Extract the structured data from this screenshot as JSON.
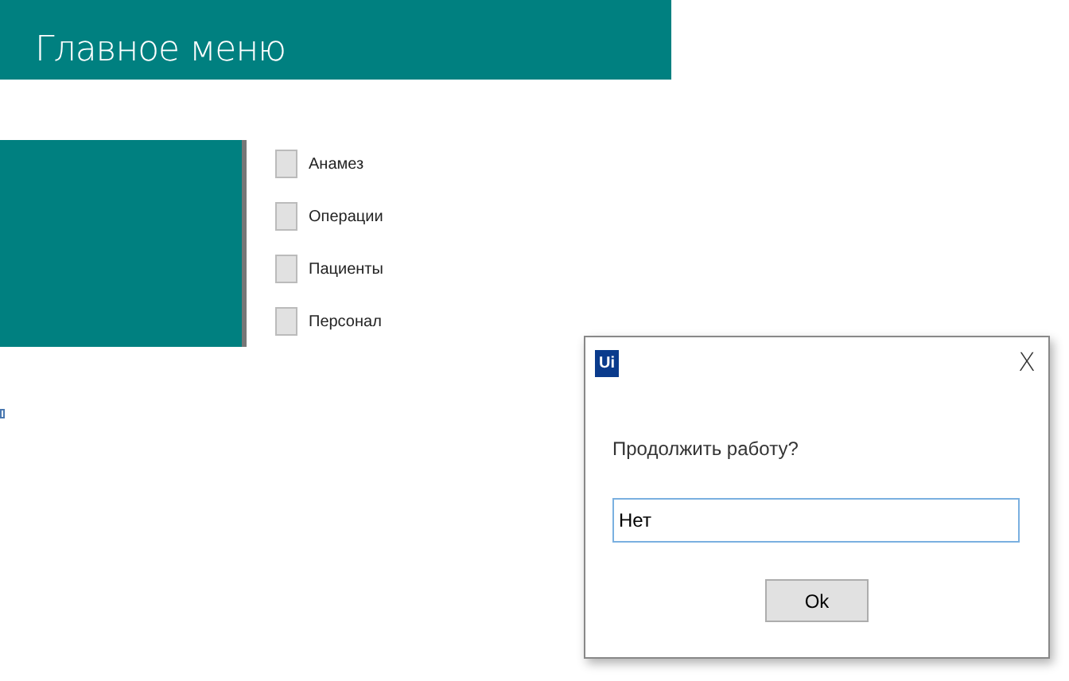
{
  "header": {
    "title": "Главное меню"
  },
  "menu_items": [
    {
      "label": "Анамез",
      "checked": false
    },
    {
      "label": "Операции",
      "checked": false
    },
    {
      "label": "Пациенты",
      "checked": false
    },
    {
      "label": "Персонал",
      "checked": false
    }
  ],
  "dialog": {
    "logo": "Ui",
    "close": "X",
    "message": "Продолжить работу?",
    "value": "Нет",
    "button": "Ok"
  }
}
